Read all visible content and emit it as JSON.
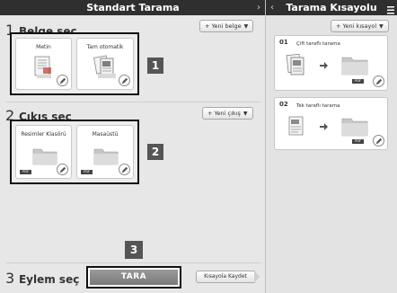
{
  "left_title": "Standart Tarama",
  "right_title": "Tarama Kısayolu",
  "step1": {
    "number": "1",
    "label": "Belge seç",
    "button_plus": "+",
    "button": "Yeni belge",
    "cards": [
      {
        "label": "Metin"
      },
      {
        "label": "Tam otomatik"
      }
    ],
    "badge": "1"
  },
  "step2": {
    "number": "2",
    "label": "Çıkış seç",
    "button_plus": "+",
    "button": "Yeni çıkış",
    "cards": [
      {
        "label": "Resimler Klasörü",
        "tag": "PDF"
      },
      {
        "label": "Masaüstü",
        "tag": "PDF"
      }
    ],
    "badge": "2"
  },
  "step3": {
    "number": "3",
    "label": "Eylem seç",
    "badge": "3",
    "scan_button": "TARA",
    "save_button": "Kısayola Kaydet"
  },
  "right": {
    "button_plus": "+",
    "new_shortcut": "Yeni kısayol",
    "shortcuts": [
      {
        "num": "01",
        "title": "Çift taraflı tarama",
        "tag": "PDF"
      },
      {
        "num": "02",
        "title": "Tek taraflı tarama",
        "tag": "PDF"
      }
    ]
  },
  "icons": {
    "left_chevron": "chevron-right-icon",
    "right_chevron": "chevron-left-icon",
    "menu": "menu-icon",
    "edit": "pencil-icon",
    "folder": "folder-icon",
    "arrow": "arrow-right-icon"
  },
  "colors": {
    "titlebar": "#2f2f2f",
    "badge": "#555555",
    "scan_button": "#8a8a8a"
  }
}
